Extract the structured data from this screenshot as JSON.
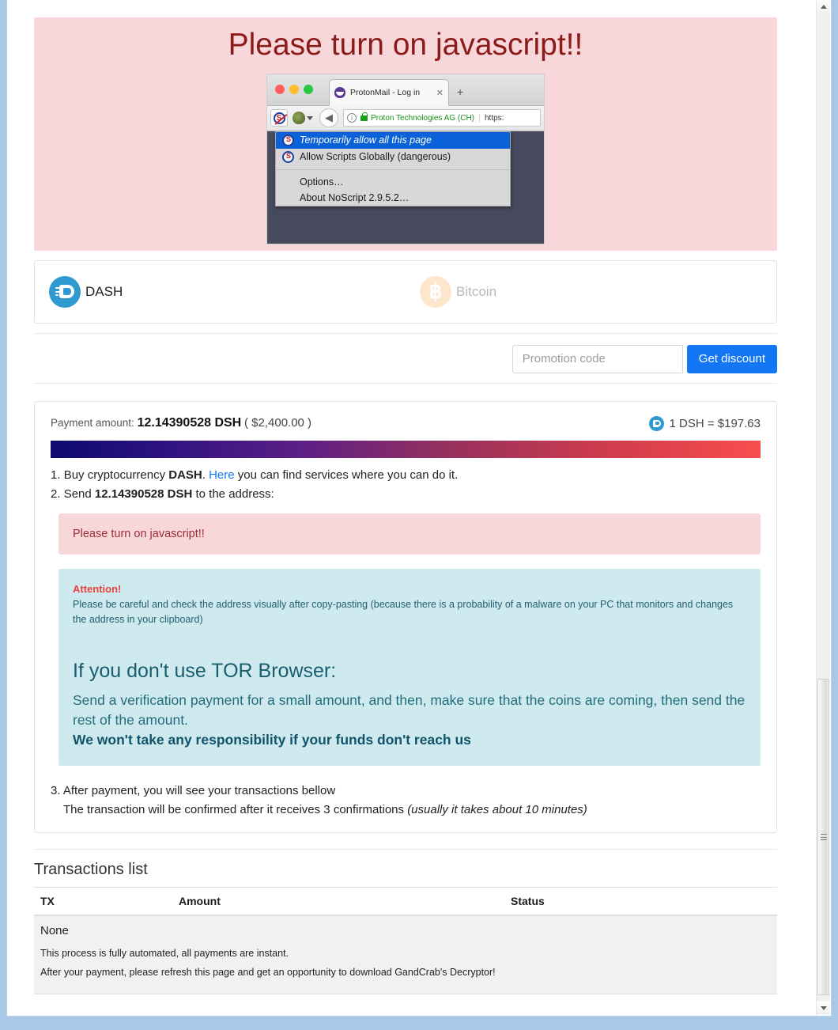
{
  "window": {
    "scrollbar": {
      "up_arrow": "▲",
      "down_arrow": "▼"
    }
  },
  "js_banner": {
    "title": "Please turn on javascript!!",
    "screenshot": {
      "browser_tab_title": "ProtonMail - Log in",
      "tab_close": "✕",
      "new_tab": "+",
      "url_org": "Proton Technologies AG (CH)",
      "url_text": "https:",
      "noscript_menu": {
        "items": [
          {
            "label": "Temporarily allow all this page",
            "selected": true
          },
          {
            "label": "Allow Scripts Globally (dangerous)",
            "selected": false
          },
          {
            "label": "Options…",
            "selected": false
          },
          {
            "label": "About NoScript 2.9.5.2…",
            "selected": false
          }
        ]
      }
    }
  },
  "currency_tabs": [
    {
      "id": "dash",
      "label": "DASH",
      "icon": "dash-coin-icon",
      "active": true,
      "color": "#2f9ad0"
    },
    {
      "id": "bitcoin",
      "label": "Bitcoin",
      "icon": "bitcoin-coin-icon",
      "active": false,
      "color": "#f7931a"
    }
  ],
  "promotion": {
    "placeholder": "Promotion code",
    "value": "",
    "button_label": "Get discount",
    "button_color": "#1276f5"
  },
  "payment": {
    "amount_label": "Payment amount:",
    "amount": "12.14390528 DSH",
    "amount_usd": "( $2,400.00 )",
    "rate": "1 DSH = $197.63",
    "gradient": {
      "from": "#0d0a6e",
      "to": "#f94d4d"
    },
    "steps": {
      "step1_number": "1.",
      "step1_pre": "Buy cryptocurrency ",
      "step1_currency": "DASH",
      "step1_dot": ". ",
      "step1_link": "Here",
      "step1_post": " you can find services where you can do it.",
      "step2_number": "2.",
      "step2_pre": "Send ",
      "step2_amount": "12.14390528 DSH",
      "step2_post": " to the address:",
      "step3_number": "3.",
      "step3_text": "After payment, you will see your transactions bellow",
      "step3_sub_pre": "The transaction will be confirmed after it receives 3 confirmations ",
      "step3_sub_italic": "(usually it takes about 10 minutes)"
    },
    "address_warning": "Please turn on javascript!!",
    "attention": {
      "title": "Attention!",
      "text": "Please be careful and check the address visually after copy-pasting (because there is a probability of a malware on your PC that monitors and changes the address in your clipboard)",
      "tor_title": "If you don't use TOR Browser:",
      "tor_body": "Send a verification payment for a small amount, and then, make sure that the coins are coming, then send the rest of the amount.",
      "tor_bold": "We won't take any responsibility if your funds don't reach us"
    }
  },
  "transactions": {
    "title": "Transactions list",
    "columns": [
      "TX",
      "Amount",
      "Status"
    ],
    "empty_label": "None",
    "notes": [
      "This process is fully automated, all payments are instant.",
      "After your payment, please refresh this page and get an opportunity to download GandCrab's Decryptor!"
    ]
  }
}
